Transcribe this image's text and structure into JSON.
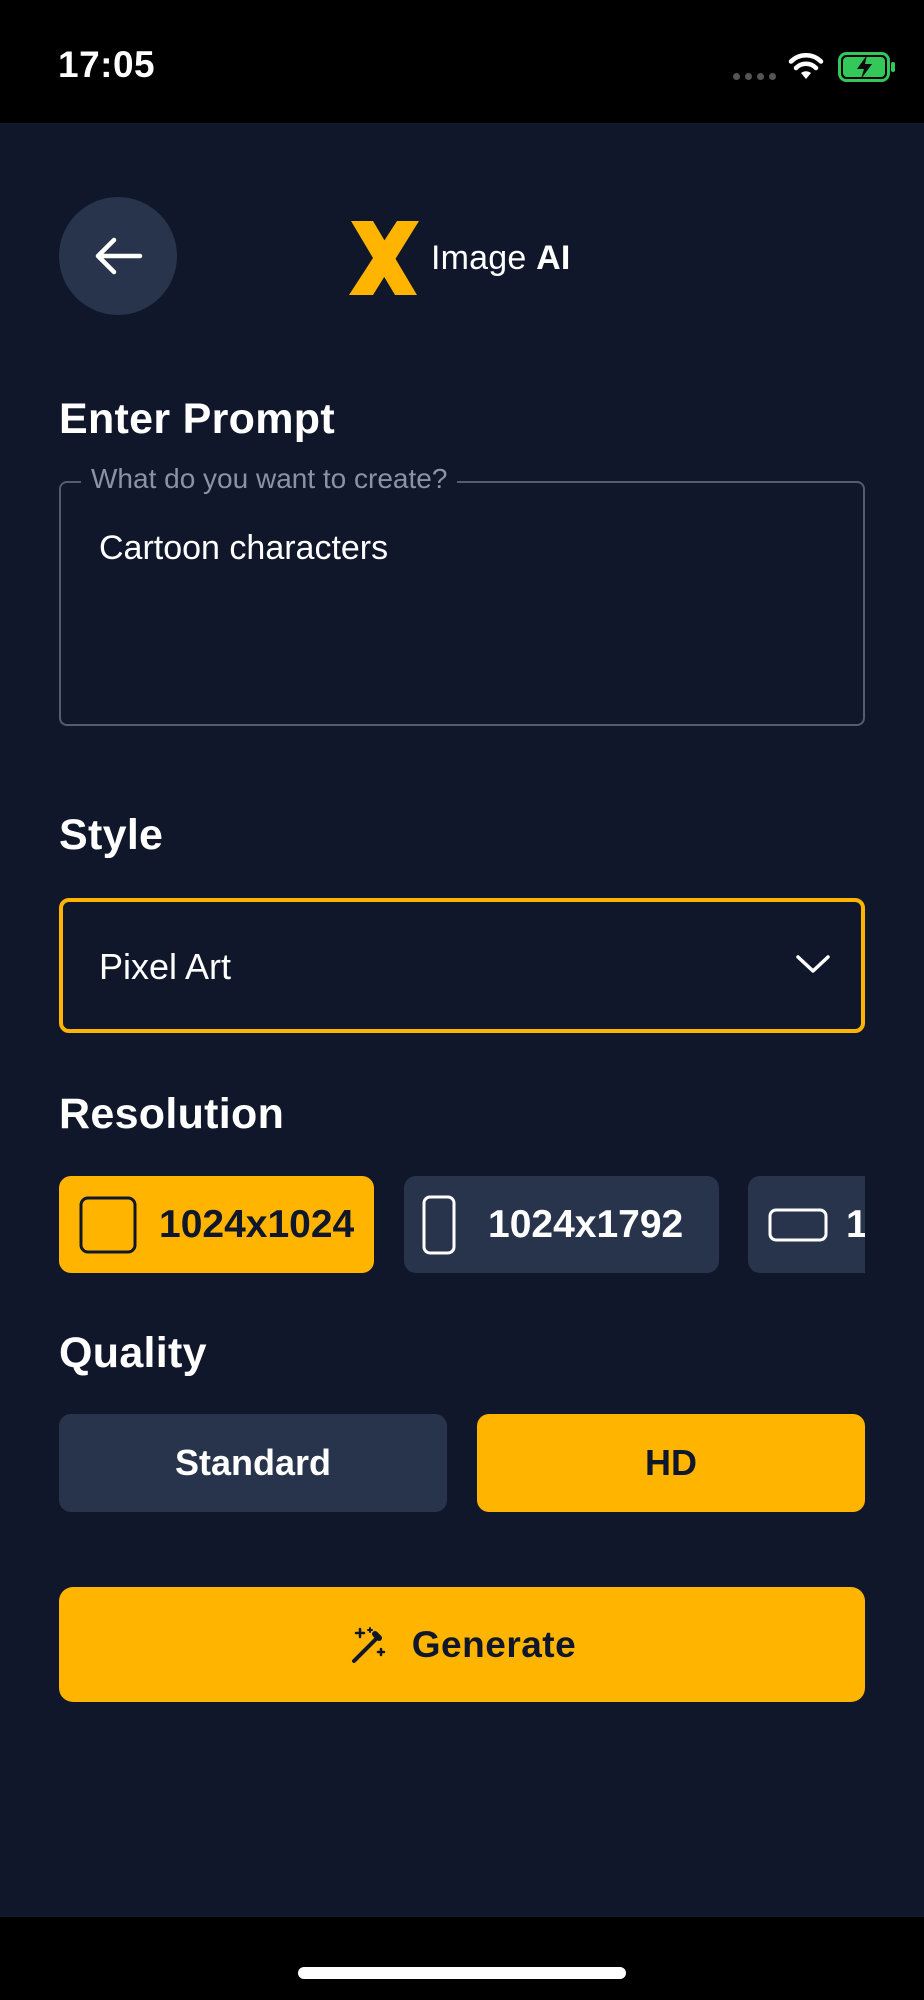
{
  "status_bar": {
    "time": "17:05",
    "icons": [
      "signal-dots-icon",
      "wifi-icon",
      "battery-charging-icon"
    ]
  },
  "header": {
    "back_icon": "arrow-left-icon",
    "logo_mark": "X",
    "logo_text_regular": "Image ",
    "logo_text_bold": "AI"
  },
  "prompt": {
    "section_title": "Enter Prompt",
    "label": "What do you want to create?",
    "value": "Cartoon characters"
  },
  "style": {
    "section_title": "Style",
    "selected": "Pixel Art",
    "dropdown_icon": "chevron-down-icon"
  },
  "resolution": {
    "section_title": "Resolution",
    "options": [
      {
        "label": "1024x1024",
        "icon": "square-icon",
        "selected": true
      },
      {
        "label": "1024x1792",
        "icon": "portrait-icon",
        "selected": false
      },
      {
        "label": "1",
        "icon": "landscape-icon",
        "selected": false
      }
    ]
  },
  "quality": {
    "section_title": "Quality",
    "options": [
      {
        "label": "Standard",
        "selected": false
      },
      {
        "label": "HD",
        "selected": true
      }
    ]
  },
  "generate": {
    "label": "Generate",
    "icon": "magic-wand-icon"
  },
  "colors": {
    "accent": "#ffb400",
    "background": "#11172a",
    "surface": "#27344b",
    "text": "#ffffff"
  }
}
